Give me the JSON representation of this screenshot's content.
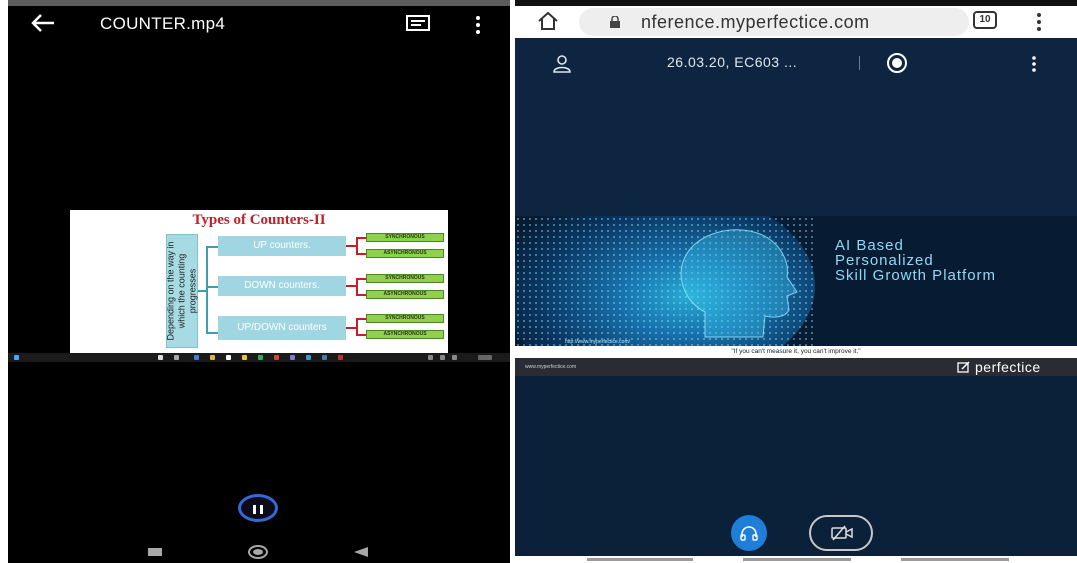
{
  "left_panel": {
    "video_title": "COUNTER.mp4",
    "icons": {
      "back": "back-arrow-icon",
      "captions": "captions-icon",
      "menu": "more-vert-icon",
      "pause": "pause-icon"
    },
    "slide": {
      "title": "Types of Counters-II",
      "vertical_label": "Depending on the way in which the counting progresses",
      "categories": [
        "UP counters.",
        "DOWN counters.",
        "UP/DOWN counters"
      ],
      "subtypes": [
        "SYNCHRONOUS",
        "ASYNCHRONOUS"
      ]
    },
    "nav": {
      "recents": "square-icon",
      "home": "circle-icon",
      "back": "triangle-back-icon"
    }
  },
  "right_panel": {
    "browser": {
      "url": "nference.myperfectice.com",
      "tab_count": "10",
      "icons": {
        "home": "home-icon",
        "lock": "lock-icon",
        "menu": "more-vert-icon"
      }
    },
    "meeting": {
      "title": "26.03.20, EC603 ...",
      "icons": {
        "participants": "user-icon",
        "record": "record-icon",
        "menu": "more-vert-icon"
      }
    },
    "banner": {
      "line1": "AI Based",
      "line2": "Personalized",
      "line3": "Skill Growth Platform",
      "url": "http://www.myperfectice.com/"
    },
    "quote": "\"If you can't measure it, you can't improve it.\"",
    "brand": {
      "site": "www.myperfectice.com",
      "name": "perfectice"
    },
    "controls": {
      "audio": "headphones-icon",
      "video": "video-off-icon"
    }
  },
  "colors": {
    "accent_blue": "#1f7ed8",
    "slide_title": "#c0202a",
    "green_box": "#8fd04c",
    "cyan_box": "#9fd6e2",
    "meeting_bg": "#0b2039"
  }
}
